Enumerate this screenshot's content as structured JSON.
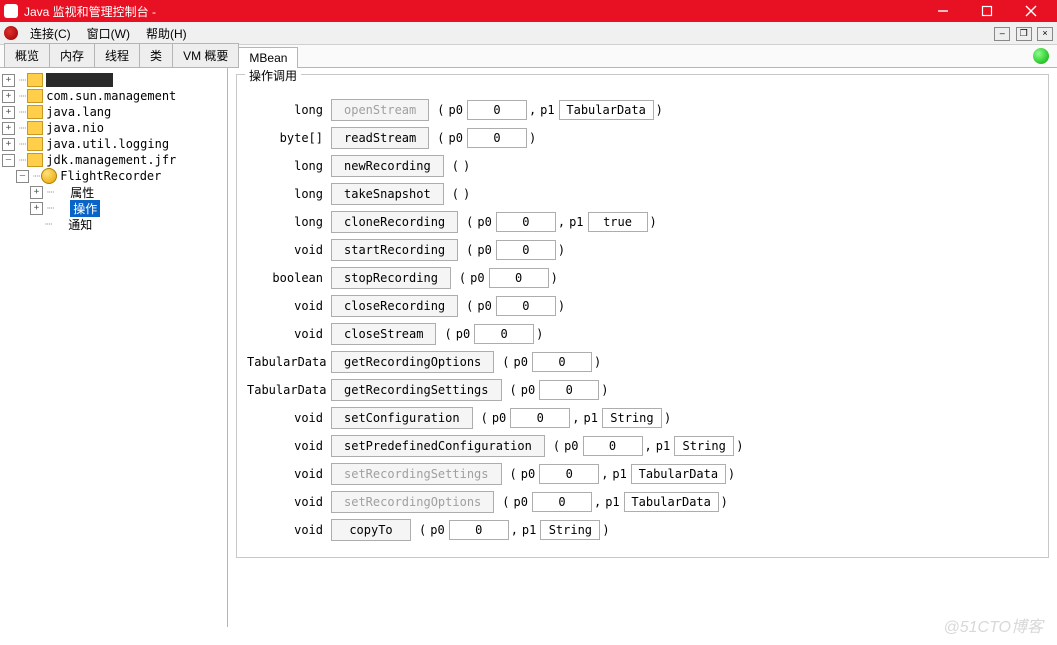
{
  "window": {
    "title": "Java 监视和管理控制台 -"
  },
  "menus": {
    "connect": "连接(C)",
    "window": "窗口(W)",
    "help": "帮助(H)"
  },
  "tabs": {
    "overview": "概览",
    "memory": "内存",
    "threads": "线程",
    "classes": "类",
    "vm": "VM 概要",
    "mbean": "MBean"
  },
  "tree": {
    "n1": "com.sun.management",
    "n2": "java.lang",
    "n3": "java.nio",
    "n4": "java.util.logging",
    "n5": "jdk.management.jfr",
    "n5a": "FlightRecorder",
    "attr": "属性",
    "ops": "操作",
    "notif": "通知"
  },
  "group": {
    "title": "操作调用"
  },
  "ops": [
    {
      "ret": "long",
      "name": "openStream",
      "disabled": true,
      "params": [
        {
          "label": "p0",
          "val": "0",
          "type": "text"
        },
        {
          "label": "p1",
          "val": "TabularData",
          "type": "text"
        }
      ]
    },
    {
      "ret": "byte[]",
      "name": "readStream",
      "disabled": false,
      "params": [
        {
          "label": "p0",
          "val": "0",
          "type": "text"
        }
      ]
    },
    {
      "ret": "long",
      "name": "newRecording",
      "disabled": false,
      "params": []
    },
    {
      "ret": "long",
      "name": "takeSnapshot",
      "disabled": false,
      "params": []
    },
    {
      "ret": "long",
      "name": "cloneRecording",
      "disabled": false,
      "params": [
        {
          "label": "p0",
          "val": "0",
          "type": "text"
        },
        {
          "label": "p1",
          "val": "true",
          "type": "text"
        }
      ]
    },
    {
      "ret": "void",
      "name": "startRecording",
      "disabled": false,
      "params": [
        {
          "label": "p0",
          "val": "0",
          "type": "text"
        }
      ]
    },
    {
      "ret": "boolean",
      "name": "stopRecording",
      "disabled": false,
      "params": [
        {
          "label": "p0",
          "val": "0",
          "type": "text"
        }
      ]
    },
    {
      "ret": "void",
      "name": "closeRecording",
      "disabled": false,
      "params": [
        {
          "label": "p0",
          "val": "0",
          "type": "text"
        }
      ]
    },
    {
      "ret": "void",
      "name": "closeStream",
      "disabled": false,
      "params": [
        {
          "label": "p0",
          "val": "0",
          "type": "text"
        }
      ]
    },
    {
      "ret": "TabularData",
      "name": "getRecordingOptions",
      "disabled": false,
      "params": [
        {
          "label": "p0",
          "val": "0",
          "type": "text"
        }
      ]
    },
    {
      "ret": "TabularData",
      "name": "getRecordingSettings",
      "disabled": false,
      "params": [
        {
          "label": "p0",
          "val": "0",
          "type": "text"
        }
      ]
    },
    {
      "ret": "void",
      "name": "setConfiguration",
      "disabled": false,
      "params": [
        {
          "label": "p0",
          "val": "0",
          "type": "text"
        },
        {
          "label": "p1",
          "val": "String",
          "type": "text"
        }
      ]
    },
    {
      "ret": "void",
      "name": "setPredefinedConfiguration",
      "disabled": false,
      "params": [
        {
          "label": "p0",
          "val": "0",
          "type": "text"
        },
        {
          "label": "p1",
          "val": "String",
          "type": "text"
        }
      ]
    },
    {
      "ret": "void",
      "name": "setRecordingSettings",
      "disabled": true,
      "params": [
        {
          "label": "p0",
          "val": "0",
          "type": "text"
        },
        {
          "label": "p1",
          "val": "TabularData",
          "type": "text"
        }
      ]
    },
    {
      "ret": "void",
      "name": "setRecordingOptions",
      "disabled": true,
      "params": [
        {
          "label": "p0",
          "val": "0",
          "type": "text"
        },
        {
          "label": "p1",
          "val": "TabularData",
          "type": "text"
        }
      ]
    },
    {
      "ret": "void",
      "name": "copyTo",
      "disabled": false,
      "params": [
        {
          "label": "p0",
          "val": "0",
          "type": "text"
        },
        {
          "label": "p1",
          "val": "String",
          "type": "text"
        }
      ]
    }
  ],
  "watermark": "@51CTO博客"
}
